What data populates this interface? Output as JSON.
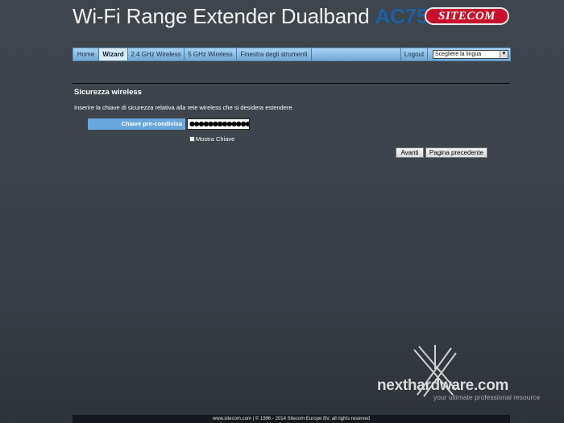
{
  "header": {
    "title": "Wi-Fi Range Extender Dualband",
    "model": "AC750",
    "brand": "SITECOM"
  },
  "nav": {
    "items": [
      {
        "label": "Home"
      },
      {
        "label": "Wizard"
      },
      {
        "label": "2.4 GHz Wireless"
      },
      {
        "label": "5 GHz Wireless"
      },
      {
        "label": "Finestra degli strumenti"
      }
    ],
    "logout": "Logout",
    "language": "Scegliere la lingua"
  },
  "section": {
    "title": "Sicurezza wireless",
    "description": "Inserire la chiave di sicurezza relativa alla rete wireless che si desidera estendere."
  },
  "form": {
    "key_label": "Chiave pre-condivisa",
    "key_value": "●●●●●●●●●●●●●●●●",
    "show_key_label": "Mostra Chiave"
  },
  "buttons": {
    "next": "Avanti",
    "previous": "Pagina precedente"
  },
  "watermark": {
    "main": "nexthardware.com",
    "tagline": "your ultimate professional resource"
  },
  "footer": {
    "text": "www.sitecom.com | © 1996 - 2014 Sitecom Europe BV, all rights reserved"
  },
  "colors": {
    "nav_gradient_top": "#a9d3f1",
    "nav_gradient_bottom": "#6fa9d7",
    "label_bg": "#6aa7dc",
    "brand_red": "#c8102e",
    "model_blue": "#1f5fa0"
  }
}
